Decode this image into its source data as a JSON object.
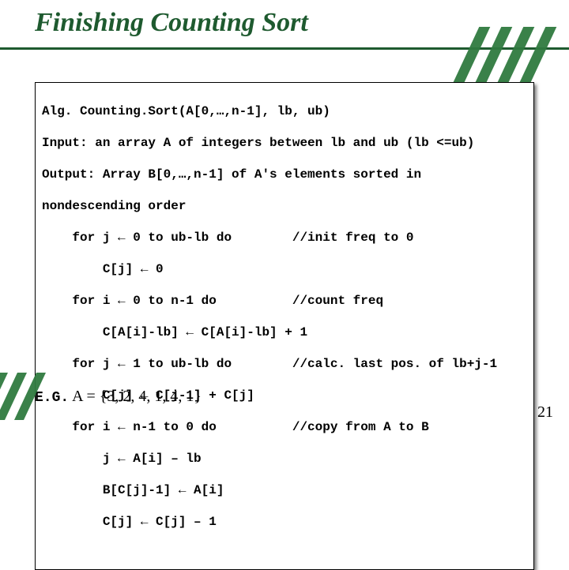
{
  "title": "Finishing Counting Sort",
  "code": {
    "l0": "Alg. Counting.Sort(A[0,…,n-1], lb, ub)",
    "l1": "Input: an array A of integers between lb and ub (lb <=ub)",
    "l2": "Output: Array B[0,…,n-1] of A's elements sorted in",
    "l3": "nondescending order",
    "l4": "    for j ← 0 to ub-lb do        //init freq to 0",
    "l5": "        C[j] ← 0",
    "l6": "    for i ← 0 to n-1 do          //count freq",
    "l7": "        C[A[i]-lb] ← C[A[i]-lb] + 1",
    "l8": "    for j ← 1 to ub-lb do        //calc. last pos. of lb+j-1",
    "l9": "        C[j] ← C[j-1] + C[j]",
    "l10": "    for i ← n-1 to 0 do          //copy from A to B",
    "l11": "        j ← A[i] – lb",
    "l12": "        B[C[j]-1] ← A[i]",
    "l13": "        C[j] ← C[j] – 1"
  },
  "example": {
    "lead": "E.G.",
    "rest": "  A = {3, 2, 4, 1, 4, 1}"
  },
  "page_number": "21"
}
